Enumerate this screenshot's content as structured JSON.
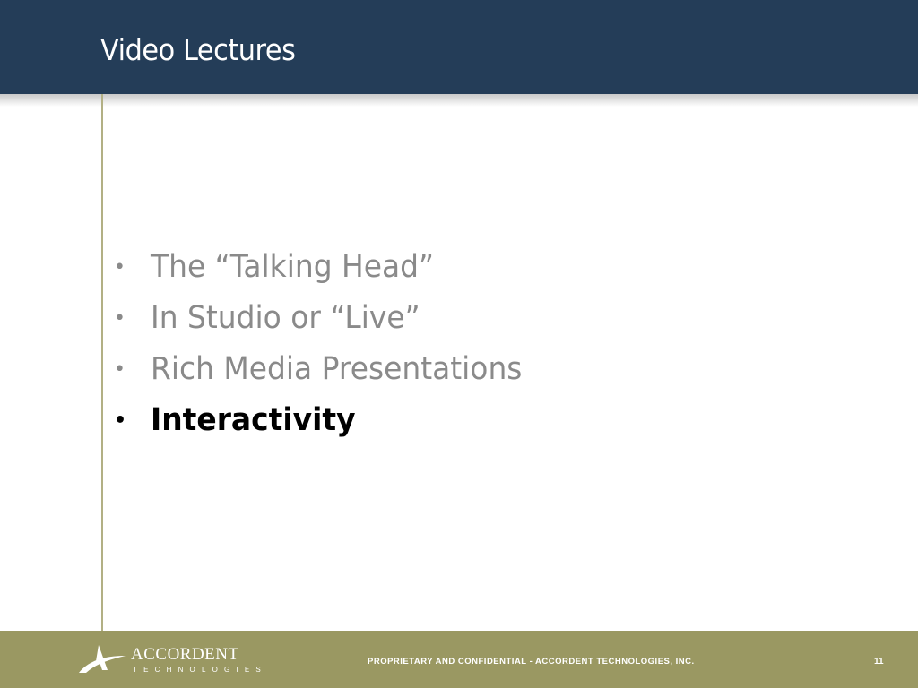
{
  "slide": {
    "title": "Video Lectures",
    "bullets": [
      {
        "text": "The “Talking Head”",
        "active": false
      },
      {
        "text": "In Studio or “Live”",
        "active": false
      },
      {
        "text": "Rich Media Presentations",
        "active": false
      },
      {
        "text": "Interactivity",
        "active": true
      }
    ],
    "bullet_glyph": "•"
  },
  "footer": {
    "logo_name": "ACCORDENT",
    "logo_subtitle": "TECHNOLOGIES",
    "confidential": "PROPRIETARY AND CONFIDENTIAL - ACCORDENT TECHNOLOGIES, INC.",
    "page_number": "11"
  },
  "colors": {
    "header_bg": "#243d58",
    "footer_bg": "#9a9862",
    "rule": "#b2b084",
    "inactive_text": "#8a8a8a",
    "active_text": "#000000"
  },
  "icons": {
    "logo": "accordent-a-swoosh-icon"
  }
}
